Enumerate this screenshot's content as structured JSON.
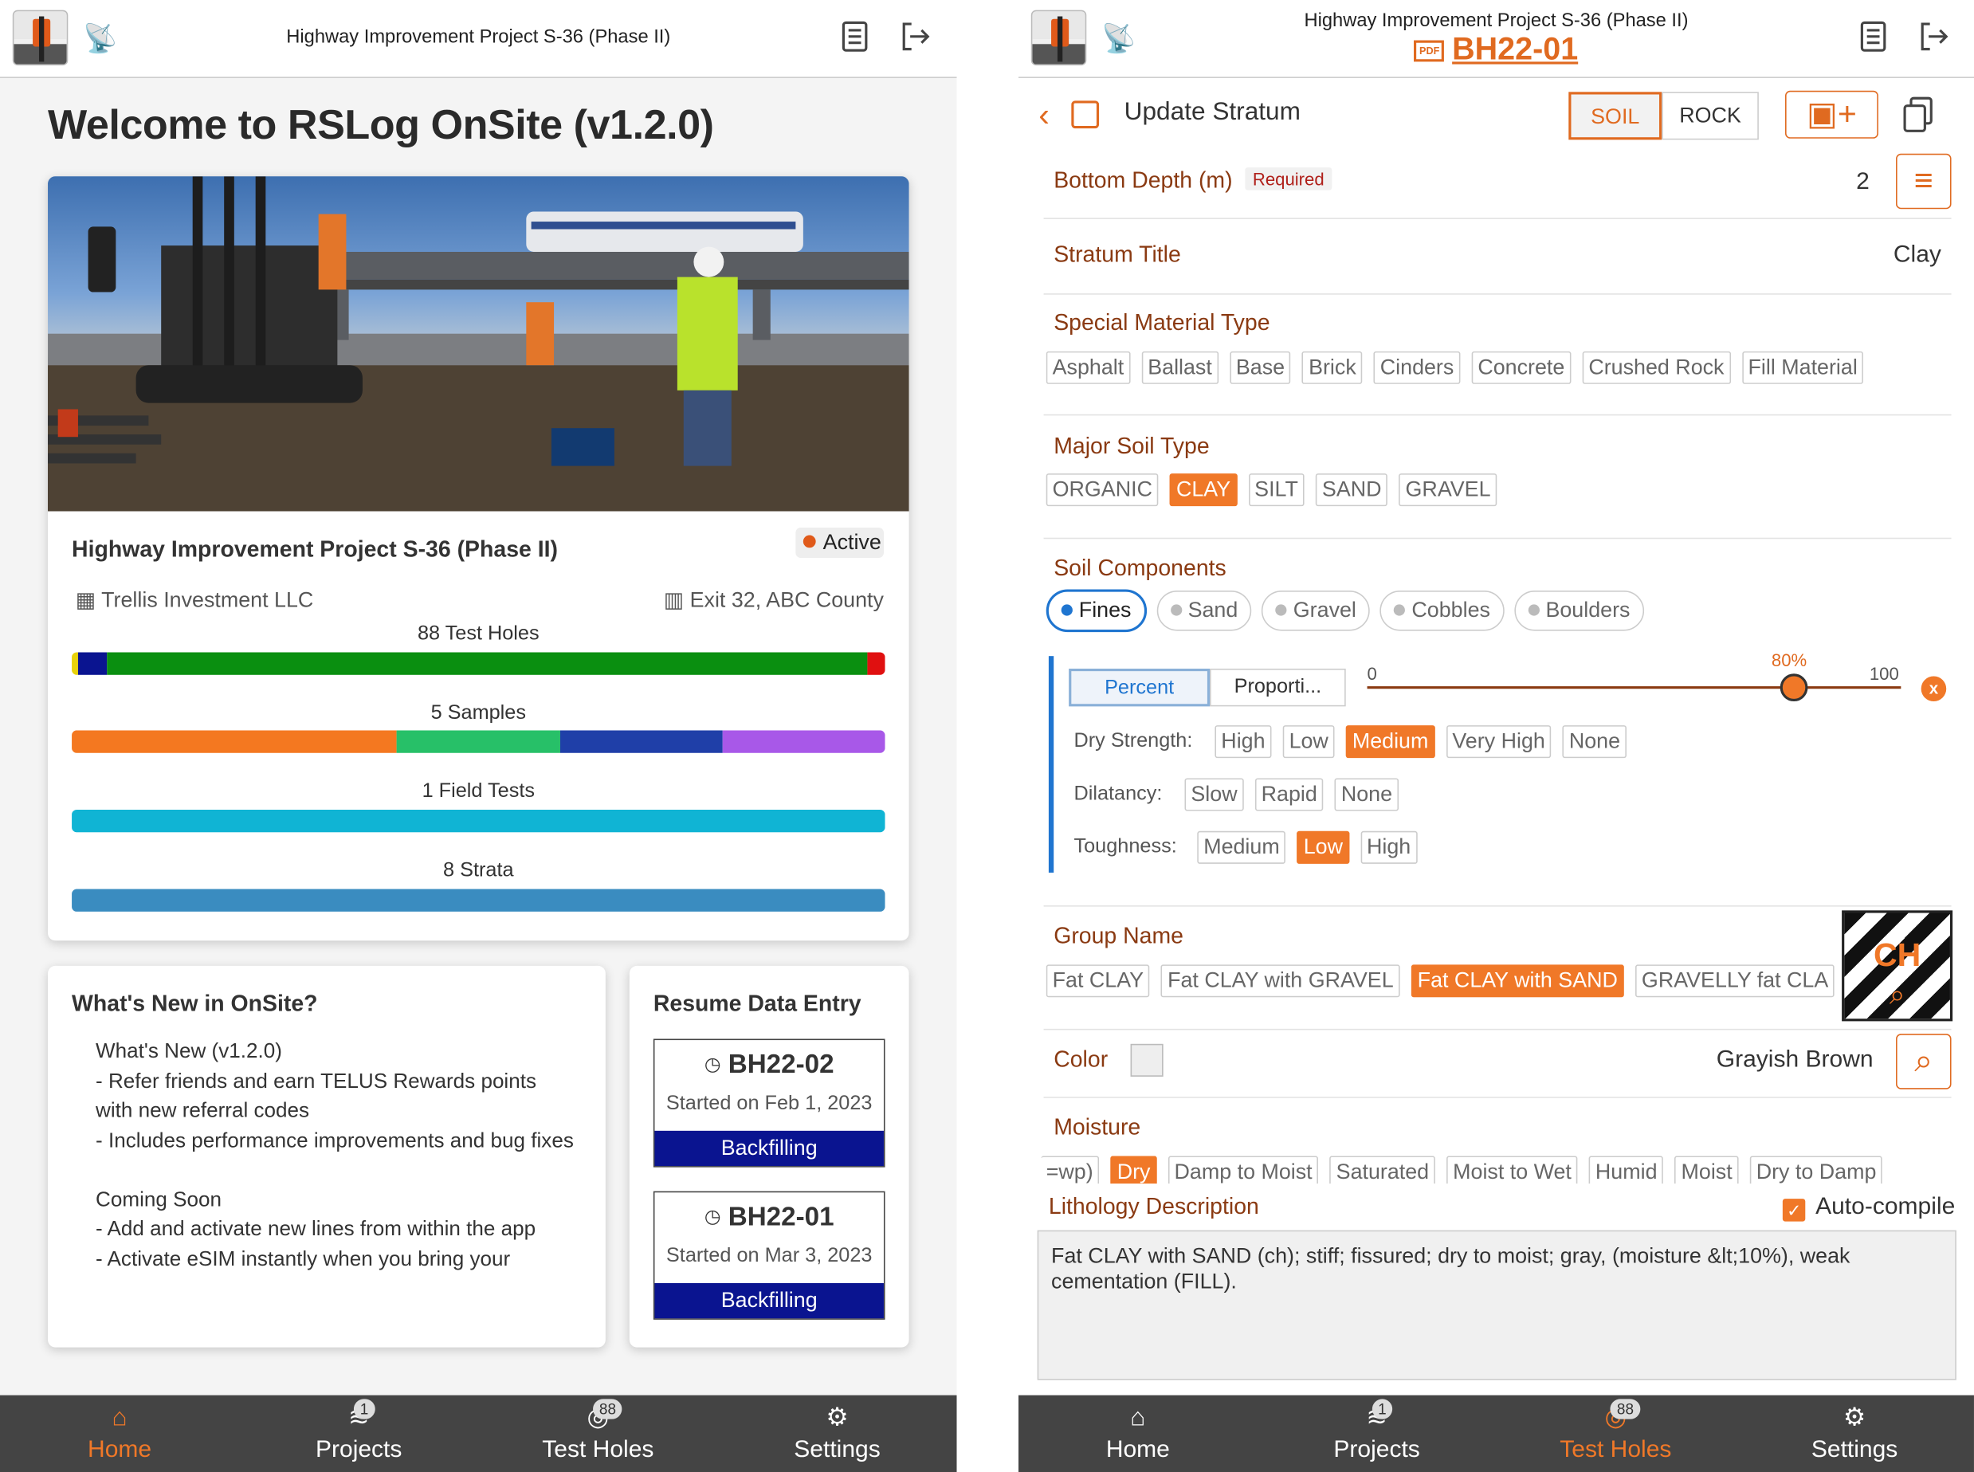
{
  "left": {
    "topbar": {
      "title": "Highway Improvement Project S-36 (Phase II)"
    },
    "welcome": "Welcome to RSLog OnSite (v1.2.0)",
    "project": {
      "title": "Highway Improvement Project S-36 (Phase II)",
      "status": "Active",
      "client": "Trellis Investment LLC",
      "location": "Exit 32, ABC County",
      "stats": [
        {
          "label": "88 Test Holes",
          "segments": [
            {
              "color": "#e8d20a",
              "pct": 0.8
            },
            {
              "color": "#0a1490",
              "pct": 3.6
            },
            {
              "color": "#0a8f10",
              "pct": 93.4
            },
            {
              "color": "#e01010",
              "pct": 2.2
            }
          ]
        },
        {
          "label": "5 Samples",
          "segments": [
            {
              "color": "#f47820",
              "pct": 40
            },
            {
              "color": "#27c068",
              "pct": 20
            },
            {
              "color": "#1f3fa8",
              "pct": 20
            },
            {
              "color": "#a858e8",
              "pct": 20
            }
          ]
        },
        {
          "label": "1 Field Tests",
          "segments": [
            {
              "color": "#10b4d4",
              "pct": 100
            }
          ]
        },
        {
          "label": "8 Strata",
          "segments": [
            {
              "color": "#3a8cc0",
              "pct": 100
            }
          ]
        }
      ]
    },
    "news": {
      "heading": "What's New in OnSite?",
      "lines": [
        "What's New (v1.2.0)",
        "- Refer friends and earn TELUS Rewards points with new referral codes",
        "- Includes performance improvements and bug fixes",
        "",
        "Coming Soon",
        "- Add and activate new lines from within the app",
        "- Activate eSIM instantly when you bring your"
      ]
    },
    "resume": {
      "heading": "Resume Data Entry",
      "items": [
        {
          "id": "BH22-02",
          "date": "Started on Feb 1, 2023",
          "status": "Backfilling"
        },
        {
          "id": "BH22-01",
          "date": "Started on Mar 3, 2023",
          "status": "Backfilling"
        }
      ]
    }
  },
  "nav": {
    "home": "Home",
    "projects": "Projects",
    "projects_count": "1",
    "testholes": "Test Holes",
    "testholes_count": "88",
    "settings": "Settings"
  },
  "right": {
    "topbar": {
      "title": "Highway Improvement Project S-36 (Phase II)",
      "hole_id": "BH22-01",
      "pdf_label": "PDF"
    },
    "header": {
      "title": "Update Stratum",
      "soil": "SOIL",
      "rock": "ROCK"
    },
    "bottom_depth": {
      "label": "Bottom Depth (m)",
      "required": "Required",
      "value": "2"
    },
    "stratum_title": {
      "label": "Stratum Title",
      "value": "Clay"
    },
    "special_material": {
      "label": "Special Material Type",
      "options": [
        "Asphalt",
        "Ballast",
        "Base",
        "Brick",
        "Cinders",
        "Concrete",
        "Crushed Rock",
        "Fill Material"
      ]
    },
    "major_soil": {
      "label": "Major Soil Type",
      "options": [
        "ORGANIC",
        "CLAY",
        "SILT",
        "SAND",
        "GRAVEL"
      ],
      "selected": "CLAY"
    },
    "soil_components": {
      "label": "Soil Components",
      "options": [
        "Fines",
        "Sand",
        "Gravel",
        "Cobbles",
        "Boulders"
      ],
      "selected": "Fines",
      "mode_percent": "Percent",
      "mode_proportion": "Proporti...",
      "slider_min": "0",
      "slider_max": "100",
      "slider_value": "80%",
      "slider_fraction": 0.8,
      "dry_strength": {
        "label": "Dry Strength:",
        "options": [
          "High",
          "Low",
          "Medium",
          "Very High",
          "None"
        ],
        "selected": "Medium"
      },
      "dilatancy": {
        "label": "Dilatancy:",
        "options": [
          "Slow",
          "Rapid",
          "None"
        ],
        "selected": ""
      },
      "toughness": {
        "label": "Toughness:",
        "options": [
          "Medium",
          "Low",
          "High"
        ],
        "selected": "Low"
      }
    },
    "group_name": {
      "label": "Group Name",
      "options": [
        "Fat CLAY",
        "Fat CLAY with GRAVEL",
        "Fat CLAY with SAND",
        "GRAVELLY fat CLA"
      ],
      "selected": "Fat CLAY with SAND",
      "symbol": "CH"
    },
    "color": {
      "label": "Color",
      "value": "Grayish Brown"
    },
    "moisture": {
      "label": "Moisture",
      "options": [
        "=wp)",
        "Dry",
        "Damp to Moist",
        "Saturated",
        "Moist to Wet",
        "Humid",
        "Moist",
        "Dry to Damp"
      ],
      "selected": "Dry"
    },
    "lithology": {
      "label": "Lithology Description",
      "autocompile": "Auto-compile",
      "text": "Fat CLAY with SAND (ch); stiff; fissured; dry to moist; gray, (moisture &lt;10%), weak cementation       (FILL)."
    }
  }
}
